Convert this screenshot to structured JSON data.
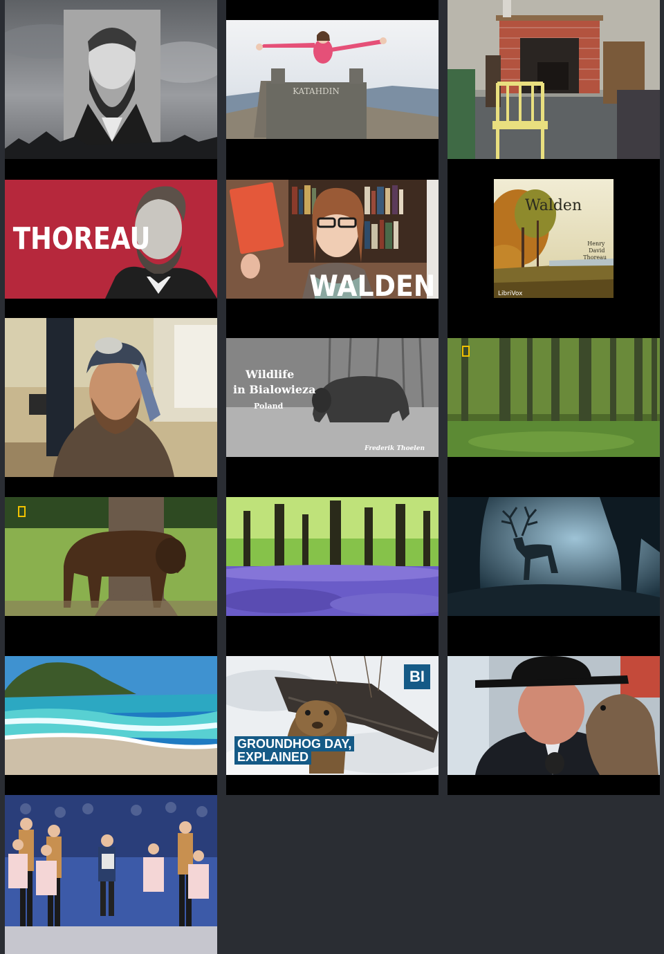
{
  "tiles": [
    {
      "id": "thoreau-portrait-photo"
    },
    {
      "id": "katahdin-summit",
      "sign_text": "KATAHDIN"
    },
    {
      "id": "thoreau-cabin-interior"
    },
    {
      "id": "thoreau-title-card",
      "title": "THOREAU"
    },
    {
      "id": "walden-vlog",
      "title": "WALDEN"
    },
    {
      "id": "walden-librivox-cover",
      "title": "Walden",
      "author": "Henry David Thoreau",
      "publisher": "LibriVox"
    },
    {
      "id": "man-in-kitchen"
    },
    {
      "id": "wildlife-bialowieza",
      "title_line1": "Wildlife",
      "title_line2": "in Bialowieza",
      "subtitle": "Poland",
      "credit": "Frederik Thoelen"
    },
    {
      "id": "forest-natgeo"
    },
    {
      "id": "bison-natgeo"
    },
    {
      "id": "bluebell-forest"
    },
    {
      "id": "stag-dark-forest"
    },
    {
      "id": "tropical-beach"
    },
    {
      "id": "groundhog-day-explained",
      "badge": "BI",
      "title": "GROUNDHOG DAY, EXPLAINED"
    },
    {
      "id": "groundhog-handler"
    },
    {
      "id": "accordion-dancers"
    }
  ]
}
